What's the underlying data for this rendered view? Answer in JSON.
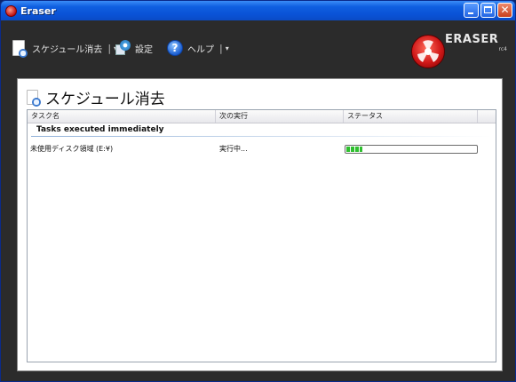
{
  "window": {
    "title": "Eraser"
  },
  "toolbar": {
    "schedule_label": "スケジュール消去",
    "settings_label": "設定",
    "help_label": "ヘルプ",
    "separator": "|",
    "caret": "▾"
  },
  "logo": {
    "text": "ERASER",
    "version": "rc4"
  },
  "pane": {
    "title": "スケジュール消去"
  },
  "listview": {
    "columns": [
      "タスク名",
      "次の実行",
      "ステータス"
    ],
    "group_title": "Tasks executed immediately",
    "tasks": [
      {
        "name": "未使用ディスク領域 (E:¥)",
        "next_run": "実行中...",
        "progress": 0.12
      }
    ]
  },
  "colors": {
    "toolbar_bg": "#2b2b2b",
    "progress_green": "#2fbf2f",
    "titlebar_blue": "#0a52d6"
  },
  "icons": {
    "schedule": "document-clock-icon",
    "settings": "settings-icon",
    "help": "help-icon",
    "logo": "eraser-logo-icon"
  }
}
